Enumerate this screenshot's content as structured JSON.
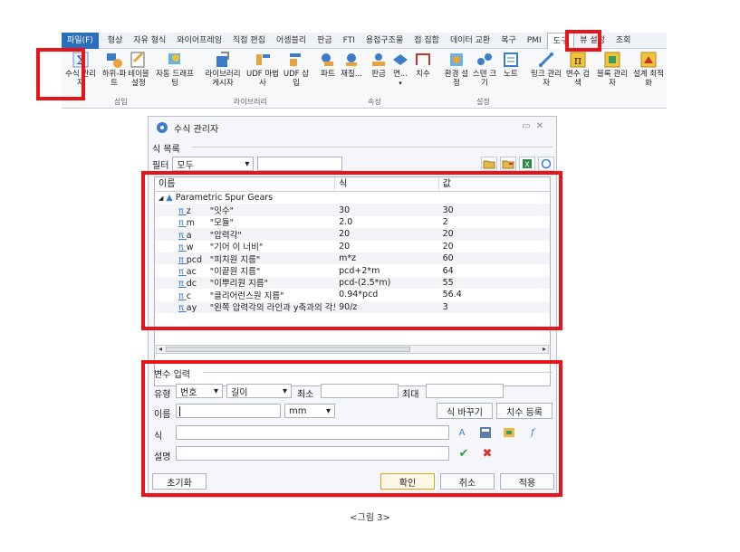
{
  "ribbon": {
    "tabs": [
      "파일(F)",
      "형상",
      "자유 형식",
      "와이어프레임",
      "직접 편집",
      "어셈블리",
      "판금",
      "FTI",
      "용접구조물",
      "점 집합",
      "데이터 교환",
      "복구",
      "PMI",
      "도구",
      "뷰 설정",
      "조회"
    ],
    "tools": [
      {
        "label1": "수식 관리",
        "label2": "자",
        "icon": "sigma-icon"
      },
      {
        "label1": "하위-파트",
        "label2": "",
        "icon": "subpart-icon"
      },
      {
        "label1": "테이블",
        "label2": "설정",
        "icon": "table-icon"
      },
      {
        "label1": "자동 드래프",
        "label2": "팅",
        "icon": "autodraft-icon"
      },
      {
        "label1": "라이브러리",
        "label2": "게시자",
        "icon": "library-icon"
      },
      {
        "label1": "UDF 마법",
        "label2": "사",
        "icon": "udf-wizard-icon"
      },
      {
        "label1": "UDF 삽",
        "label2": "입",
        "icon": "udf-insert-icon"
      },
      {
        "label1": "파트",
        "label2": "",
        "icon": "part-icon"
      },
      {
        "label1": "재질...",
        "label2": "",
        "icon": "material-icon"
      },
      {
        "label1": "판금",
        "label2": "",
        "icon": "sheetmetal-icon"
      },
      {
        "label1": "면...",
        "label2": "",
        "icon": "face-icon"
      },
      {
        "label1": "치수",
        "label2": "",
        "icon": "dimension-icon"
      },
      {
        "label1": "환경 설",
        "label2": "정",
        "icon": "env-icon"
      },
      {
        "label1": "스텐 크",
        "label2": "기",
        "icon": "stencil-icon"
      },
      {
        "label1": "노트",
        "label2": "",
        "icon": "note-icon"
      },
      {
        "label1": "링크 관리",
        "label2": "자",
        "icon": "link-icon"
      },
      {
        "label1": "변수 검",
        "label2": "색",
        "icon": "pi-icon"
      },
      {
        "label1": "블록 관리",
        "label2": "자",
        "icon": "block-icon"
      },
      {
        "label1": "설계 최적",
        "label2": "화",
        "icon": "optimize-icon"
      }
    ],
    "groups": [
      "삽입",
      "라이브러리",
      "속성",
      "설정"
    ]
  },
  "dialog": {
    "title": "수식 관리자",
    "list_section": "식 목록",
    "filter_label": "필터",
    "filter_value": "모두",
    "columns": [
      "이름",
      "식",
      "값"
    ],
    "group_name": "Parametric Spur Gears",
    "rows": [
      {
        "name": "z",
        "desc": "\"잇수\"",
        "expr": "30",
        "value": "30"
      },
      {
        "name": "m",
        "desc": "\"모듈\"",
        "expr": "2.0",
        "value": "2"
      },
      {
        "name": "a",
        "desc": "\"압력각\"",
        "expr": "20",
        "value": "20"
      },
      {
        "name": "w",
        "desc": "\"기어 이 너비\"",
        "expr": "20",
        "value": "20"
      },
      {
        "name": "pcd",
        "desc": "\"피치원 지름\"",
        "expr": "m*z",
        "value": "60"
      },
      {
        "name": "ac",
        "desc": "\"이끝원 지름\"",
        "expr": "pcd+2*m",
        "value": "64"
      },
      {
        "name": "dc",
        "desc": "\"이뿌리원 지름\"",
        "expr": "pcd-(2.5*m)",
        "value": "55"
      },
      {
        "name": "c",
        "desc": "\"클리어런스원 지름\"",
        "expr": "0.94*pcd",
        "value": "56.4"
      },
      {
        "name": "ay",
        "desc": "\"왼쪽 압력각의 라인과 y축과의 각도\"",
        "expr": "90/z",
        "value": "3"
      }
    ],
    "input_section": "변수 입력",
    "type_label": "유형",
    "type_value": "번호",
    "kind_value": "길이",
    "min_label": "최소",
    "max_label": "최대",
    "name_label": "이름",
    "unit_value": "mm",
    "swap_button": "식 바꾸기",
    "dim_button": "치수 등록",
    "expr_label": "식",
    "desc_label": "설명",
    "reset_button": "초기화",
    "ok_button": "확인",
    "cancel_button": "취소",
    "apply_button": "적용"
  },
  "caption": "<그림 3>"
}
